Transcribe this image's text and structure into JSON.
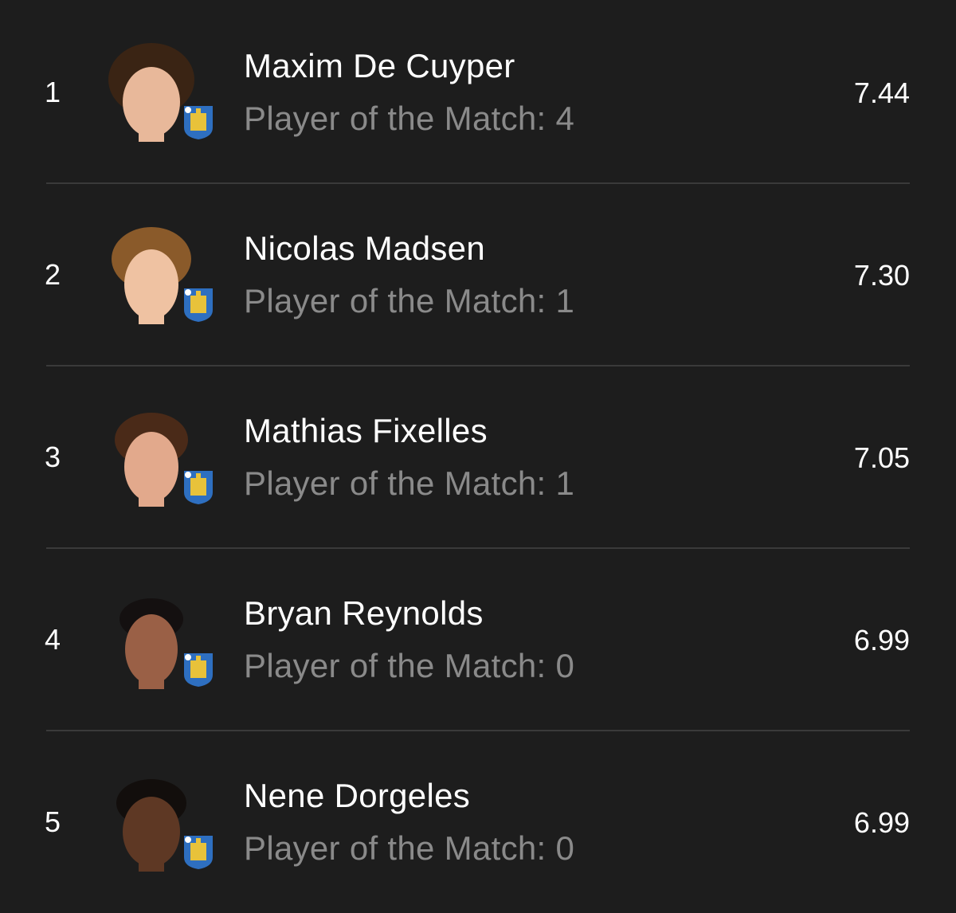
{
  "players": [
    {
      "rank": "1",
      "name": "Maxim De Cuyper",
      "potm_label": "Player of the Match: 4",
      "rating": "7.44",
      "avatar": "player-photo",
      "badge": "club-crest-icon",
      "hair_color": "#3a2414",
      "skin_color": "#e8b89a"
    },
    {
      "rank": "2",
      "name": "Nicolas Madsen",
      "potm_label": "Player of the Match: 1",
      "rating": "7.30",
      "avatar": "player-photo",
      "badge": "club-crest-icon",
      "hair_color": "#8a5a2a",
      "skin_color": "#efc2a2"
    },
    {
      "rank": "3",
      "name": "Mathias Fixelles",
      "potm_label": "Player of the Match: 1",
      "rating": "7.05",
      "avatar": "player-photo",
      "badge": "club-crest-icon",
      "hair_color": "#4a2a18",
      "skin_color": "#e2a98c"
    },
    {
      "rank": "4",
      "name": "Bryan Reynolds",
      "potm_label": "Player of the Match: 0",
      "rating": "6.99",
      "avatar": "player-photo",
      "badge": "club-crest-icon",
      "hair_color": "#141010",
      "skin_color": "#9a6046"
    },
    {
      "rank": "5",
      "name": "Nene Dorgeles",
      "potm_label": "Player of the Match: 0",
      "rating": "6.99",
      "avatar": "player-photo",
      "badge": "club-crest-icon",
      "hair_color": "#120e0c",
      "skin_color": "#5e3824"
    }
  ],
  "colors": {
    "background": "#1d1d1d",
    "primary_text": "#ffffff",
    "secondary_text": "#8a8a8a",
    "divider": "#3a3a3a",
    "crest_blue": "#2e6fc0",
    "crest_gold": "#e8c23a"
  }
}
